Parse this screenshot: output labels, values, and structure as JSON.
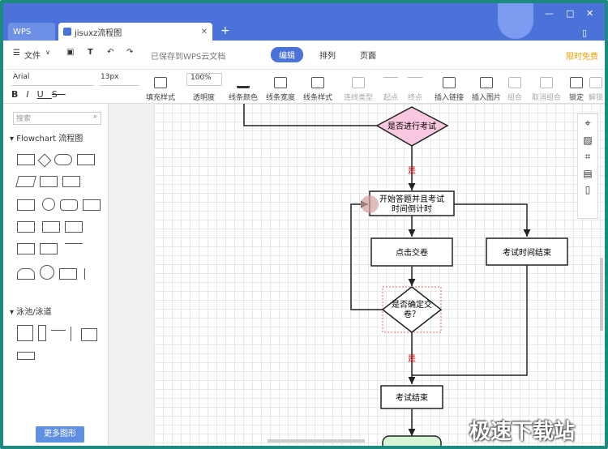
{
  "titlebar": {
    "tab_wps": "WPS",
    "tab_doc": "jisuxz流程图",
    "new_tab": "+"
  },
  "menubar": {
    "file": "文件",
    "saved_status": "已保存到WPS云文档",
    "tabs": [
      "编辑",
      "排列",
      "页面"
    ],
    "free_label": "限时免费"
  },
  "toolbar": {
    "font": "Arial",
    "font_size": "13px",
    "opacity_value": "100%",
    "buttons": [
      "填充样式",
      "透明度",
      "线条颜色",
      "线条宽度",
      "线条样式",
      "连线类型",
      "起点",
      "终点",
      "插入链接",
      "插入图片",
      "组合",
      "取消组合",
      "锁定",
      "解锁"
    ]
  },
  "left": {
    "search_placeholder": "搜索",
    "section1": "Flowchart 流程图",
    "section2": "泳池/泳道",
    "more_shapes": "更多图形"
  },
  "flow": {
    "decision_top": "是否进行考试",
    "yes1": "是",
    "start_answer": "开始答题并且考试",
    "start_answer2": "时间倒计时",
    "submit": "点击交卷",
    "time_up": "考试时间结束",
    "confirm1": "是否确定交",
    "confirm2": "卷？",
    "yes2": "是",
    "end": "考试结束"
  },
  "watermark": "极速下载站"
}
